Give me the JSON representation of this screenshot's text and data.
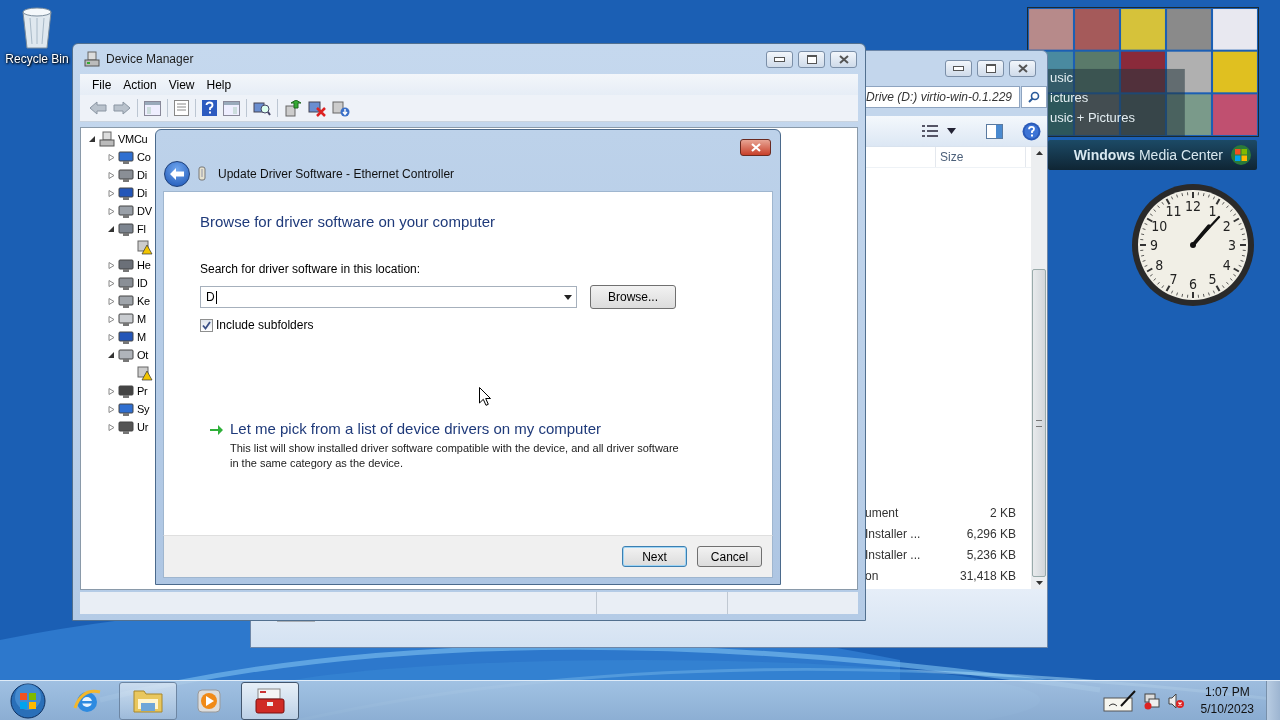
{
  "desktop_icons": [
    {
      "label": "Recycle Bin"
    }
  ],
  "explorer_window": {
    "address": "Drive (D:) virtio-win-0.1.229",
    "columns": [
      "Size"
    ],
    "rows": [
      {
        "type": "ument",
        "size": "2 KB"
      },
      {
        "type": "Installer ...",
        "size": "6,296 KB"
      },
      {
        "type": "Installer ...",
        "size": "5,236 KB"
      },
      {
        "type": "on",
        "size": "31,418 KB"
      }
    ]
  },
  "device_manager": {
    "title": "Device Manager",
    "menu": [
      "File",
      "Action",
      "View",
      "Help"
    ],
    "tree": {
      "label": "VMCu",
      "expanded": true,
      "children": [
        {
          "label": "Co",
          "kind": "computer",
          "expanded": false
        },
        {
          "label": "Di",
          "kind": "drive",
          "expanded": false
        },
        {
          "label": "Di",
          "kind": "monitor",
          "expanded": false
        },
        {
          "label": "DV",
          "kind": "dvd",
          "expanded": false
        },
        {
          "label": "Fl",
          "kind": "floppy",
          "expanded": true,
          "children": [
            {
              "warning": true
            }
          ]
        },
        {
          "label": "He",
          "kind": "hid",
          "expanded": false
        },
        {
          "label": "ID",
          "kind": "drive",
          "expanded": false
        },
        {
          "label": "Ke",
          "kind": "keyboard",
          "expanded": false
        },
        {
          "label": "M",
          "kind": "mouse",
          "expanded": false
        },
        {
          "label": "M",
          "kind": "monitor",
          "expanded": false
        },
        {
          "label": "Ot",
          "kind": "unknown",
          "expanded": true,
          "children": [
            {
              "warning": true
            }
          ]
        },
        {
          "label": "Pr",
          "kind": "chip",
          "expanded": false
        },
        {
          "label": "Sy",
          "kind": "computer",
          "expanded": false
        },
        {
          "label": "Ur",
          "kind": "usb",
          "expanded": false
        }
      ]
    }
  },
  "dialog": {
    "title": "Update Driver Software - Ethernet Controller",
    "heading": "Browse for driver software on your computer",
    "location_label": "Search for driver software in this location:",
    "location_value": "D",
    "browse_button": "Browse...",
    "include_subfolders": {
      "label": "Include subfolders",
      "checked": true
    },
    "pick_link": "Let me pick from a list of device drivers on my computer",
    "pick_description": "This list will show installed driver software compatible with the device, and all driver software in the same category as the device.",
    "buttons": [
      {
        "label": "Next",
        "default": true
      },
      {
        "label": "Cancel",
        "default": false
      }
    ]
  },
  "media_center": {
    "items": [
      "usic",
      "ictures",
      "usic + Pictures"
    ],
    "title": "**Windows** Media Center"
  },
  "clock": {
    "numerals": [
      "12",
      "11",
      "1",
      "10",
      "2",
      "9",
      "3",
      "8",
      "4",
      "7",
      "5",
      "6"
    ]
  },
  "taskbar": {
    "apps": [
      {
        "kind": "browser",
        "running": false,
        "selected": false
      },
      {
        "kind": "folder",
        "running": true,
        "selected": false
      },
      {
        "kind": "player",
        "running": false,
        "selected": false
      },
      {
        "kind": "toolbox",
        "running": true,
        "selected": true
      }
    ],
    "time": "1:07 PM",
    "date": "5/10/2023"
  }
}
